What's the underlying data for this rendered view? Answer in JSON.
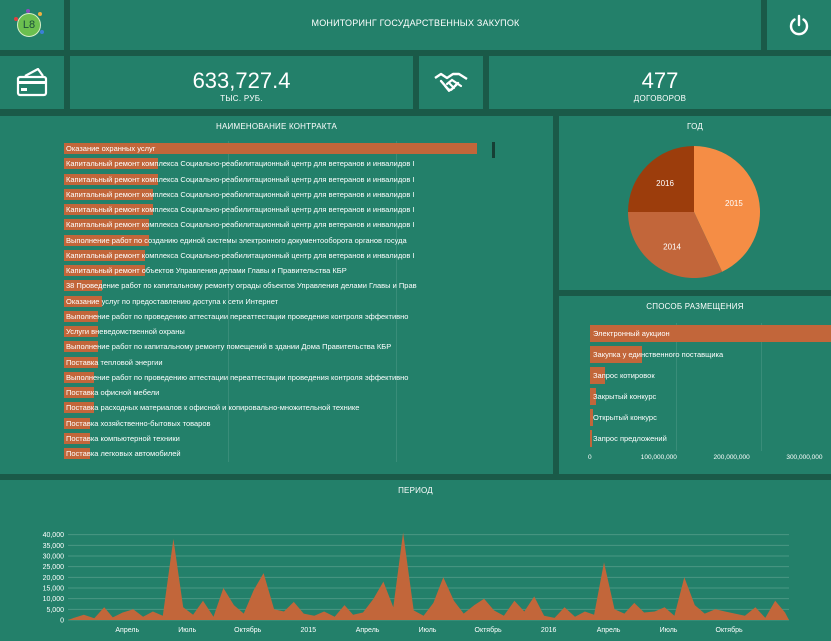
{
  "header": {
    "logo_text": "L8",
    "title": "МОНИТОРИНГ ГОСУДАРСТВЕННЫХ ЗАКУПОК"
  },
  "kpis": {
    "amount": {
      "value": "633,727.4",
      "unit": "ТЫС. РУБ."
    },
    "contracts": {
      "value": "477",
      "unit": "ДОГОВОРОВ"
    }
  },
  "icons": {
    "header_icon": "power-icon",
    "amount_icon": "payment-card-icon",
    "contracts_icon": "handshake-icon"
  },
  "colors": {
    "background": "#1a5a48",
    "panel": "#23806a",
    "bar": "#c2663a",
    "pie_2015": "#f58d45",
    "pie_2014": "#c2663a",
    "pie_2016": "#9c3d0c"
  },
  "contracts_panel": {
    "title": "НАИМЕНОВАНИЕ КОНТРАКТА",
    "items": [
      {
        "label": "Оказание охранных услуг",
        "fill": 0.97
      },
      {
        "label": "Капитальный ремонт комплекса Социально-реабилитационный центр для ветеранов и инвалидов I",
        "fill": 0.22
      },
      {
        "label": "Капитальный ремонт комплекса Социально-реабилитационный центр для ветеранов и инвалидов I",
        "fill": 0.22
      },
      {
        "label": "Капитальный ремонт комплекса Социально-реабилитационный центр для ветеранов и инвалидов I",
        "fill": 0.21
      },
      {
        "label": "Капитальный ремонт комплекса Социально-реабилитационный центр для ветеранов и инвалидов I",
        "fill": 0.21
      },
      {
        "label": "Капитальный ремонт комплекса Социально-реабилитационный центр для ветеранов и инвалидов I",
        "fill": 0.2
      },
      {
        "label": "Выполнение работ по созданию единой системы электронного документооборота органов госуда",
        "fill": 0.2
      },
      {
        "label": "Капитальный ремонт комплекса Социально-реабилитационный центр для ветеранов и инвалидов I",
        "fill": 0.19
      },
      {
        "label": "Капитальный ремонт объектов Управления делами Главы и Правительства КБР",
        "fill": 0.19
      },
      {
        "label": "38 Проведение работ по капитальному ремонту ограды объектов Управления делами Главы и Прав",
        "fill": 0.09
      },
      {
        "label": "Оказание услуг по предоставлению доступа к сети Интернет",
        "fill": 0.09
      },
      {
        "label": "Выполнение работ по проведению аттестации переаттестации проведения контроля эффективно",
        "fill": 0.08
      },
      {
        "label": "Услуги вневедомственной охраны",
        "fill": 0.08
      },
      {
        "label": "Выполнение работ по капитальному ремонту помещений в здании Дома Правительства КБР",
        "fill": 0.08
      },
      {
        "label": "Поставка тепловой энергии",
        "fill": 0.08
      },
      {
        "label": "Выполнение работ по проведению аттестации переаттестации проведения контроля эффективно",
        "fill": 0.07
      },
      {
        "label": "Поставка офисной мебели",
        "fill": 0.07
      },
      {
        "label": "Поставка расходных материалов к офисной и копировально-множительной технике",
        "fill": 0.07
      },
      {
        "label": "Поставка хозяйственно-бытовых товаров",
        "fill": 0.06
      },
      {
        "label": "Поставка компьютерной техники",
        "fill": 0.06
      },
      {
        "label": "Поставка легковых автомобилей",
        "fill": 0.06
      }
    ]
  },
  "chart_data": [
    {
      "type": "pie",
      "title": "ГОД",
      "slices": [
        {
          "label": "2015",
          "value": 43,
          "color": "#f58d45"
        },
        {
          "label": "2014",
          "value": 32,
          "color": "#c2663a"
        },
        {
          "label": "2016",
          "value": 25,
          "color": "#9c3d0c"
        }
      ]
    },
    {
      "type": "bar",
      "orientation": "horizontal",
      "title": "СПОСОБ РАЗМЕЩЕНИЯ",
      "categories": [
        "Электронный аукцион",
        "Закупка у единственного поставщика",
        "Запрос котировок",
        "Закрытый конкурс",
        "Открытый конкурс",
        "Запрос предложений"
      ],
      "values": [
        352000000,
        72000000,
        20000000,
        8000000,
        4000000,
        1000000
      ],
      "xlim": [
        0,
        360000000
      ],
      "xticks": [
        "0",
        "100,000,000",
        "200,000,000",
        "300,000,000"
      ]
    },
    {
      "type": "area",
      "title": "ПЕРИОД",
      "ylim": [
        0,
        45000
      ],
      "yticks": [
        "0",
        "5,000",
        "10,000",
        "15,000",
        "20,000",
        "25,000",
        "30,000",
        "35,000",
        "40,000"
      ],
      "xticks": [
        "Апрель",
        "Июль",
        "Октябрь",
        "2015",
        "Апрель",
        "Июль",
        "Октябрь",
        "2016",
        "Апрель",
        "Июль",
        "Октябрь"
      ],
      "x_start": "2014-01-01",
      "x_end": "2016-12-31",
      "x": [
        "2014-01-10",
        "2014-01-25",
        "2014-02-10",
        "2014-02-25",
        "2014-03-10",
        "2014-03-25",
        "2014-04-10",
        "2014-04-25",
        "2014-05-10",
        "2014-05-25",
        "2014-06-10",
        "2014-06-25",
        "2014-07-10",
        "2014-07-25",
        "2014-08-10",
        "2014-08-25",
        "2014-09-10",
        "2014-09-25",
        "2014-10-10",
        "2014-10-25",
        "2014-11-10",
        "2014-11-25",
        "2014-12-10",
        "2014-12-25",
        "2015-01-10",
        "2015-01-25",
        "2015-02-10",
        "2015-02-25",
        "2015-03-10",
        "2015-03-25",
        "2015-04-10",
        "2015-04-25",
        "2015-05-10",
        "2015-05-25",
        "2015-06-10",
        "2015-06-25",
        "2015-07-10",
        "2015-07-25",
        "2015-08-10",
        "2015-08-25",
        "2015-09-10",
        "2015-09-25",
        "2015-10-10",
        "2015-10-25",
        "2015-11-10",
        "2015-11-25",
        "2015-12-10",
        "2015-12-25",
        "2016-01-10",
        "2016-01-25",
        "2016-02-10",
        "2016-02-25",
        "2016-03-10",
        "2016-03-25",
        "2016-04-10",
        "2016-04-25",
        "2016-05-10",
        "2016-05-25",
        "2016-06-10",
        "2016-06-25",
        "2016-07-10",
        "2016-07-25",
        "2016-08-10",
        "2016-08-25",
        "2016-09-10",
        "2016-09-25",
        "2016-10-10",
        "2016-10-25",
        "2016-11-10",
        "2016-11-25",
        "2016-12-10",
        "2016-12-25"
      ],
      "y": [
        1000,
        2500,
        800,
        6000,
        1200,
        3500,
        5000,
        1500,
        4000,
        2000,
        38000,
        6000,
        2500,
        9000,
        1500,
        15000,
        7000,
        3000,
        14000,
        22000,
        5000,
        4000,
        8500,
        3000,
        2000,
        4000,
        1500,
        7000,
        2500,
        3500,
        10000,
        18000,
        6000,
        41000,
        4500,
        2000,
        8000,
        20000,
        9000,
        3000,
        7000,
        10000,
        4500,
        2000,
        9000,
        4000,
        11000,
        2000,
        1000,
        6000,
        1500,
        4000,
        2500,
        27000,
        5000,
        3000,
        8000,
        3500,
        4000,
        6000,
        2000,
        20000,
        7000,
        3000,
        5000,
        4000,
        3000,
        2000,
        6000,
        1000,
        9000,
        3500
      ]
    }
  ]
}
